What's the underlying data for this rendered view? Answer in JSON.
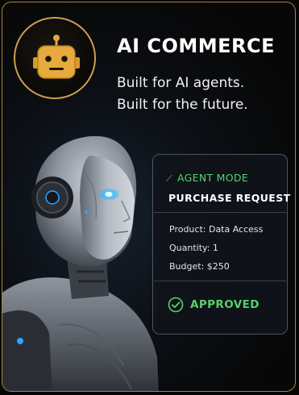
{
  "brand": {
    "title": "AI COMMERCE",
    "tagline_line1": "Built for AI agents.",
    "tagline_line2": "Built for the future.",
    "logo_icon": "robot-head-icon"
  },
  "colors": {
    "gold": "#caa04e",
    "accent_green": "#57d26a",
    "background": "#080706"
  },
  "panel": {
    "mode_icon": "sparkle-icon",
    "mode_label": "AGENT MODE",
    "request_title": "PURCHASE REQUEST",
    "details": [
      "Product: Data Access",
      "Quantity: 1",
      "Budget: $250"
    ],
    "status_icon": "check-circle-icon",
    "status_label": "APPROVED"
  }
}
